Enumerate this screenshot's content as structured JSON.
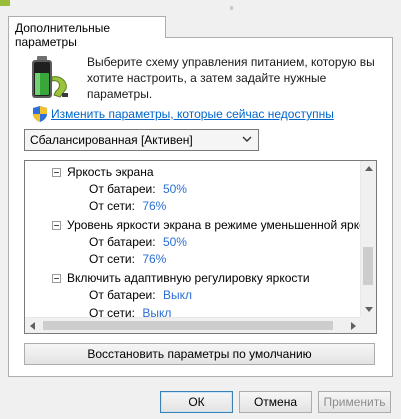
{
  "tab": {
    "label": "Дополнительные параметры"
  },
  "intro": {
    "text": "Выберите схему управления питанием, которую вы хотите настроить, а затем задайте нужные параметры."
  },
  "change_link": {
    "label": "Изменить параметры, которые сейчас недоступны"
  },
  "plan_select": {
    "value": "Сбалансированная [Активен]"
  },
  "tree": {
    "groups": [
      {
        "label": "Яркость экрана",
        "battery_label": "От батареи:",
        "battery_value": "50%",
        "ac_label": "От сети:",
        "ac_value": "76%"
      },
      {
        "label": "Уровень яркости экрана в режиме уменьшенной яркости",
        "battery_label": "От батареи:",
        "battery_value": "50%",
        "ac_label": "От сети:",
        "ac_value": "76%"
      },
      {
        "label": "Включить адаптивную регулировку яркости",
        "battery_label": "От батареи:",
        "battery_value": "Выкл",
        "ac_label": "От сети:",
        "ac_value": "Выкл"
      }
    ]
  },
  "restore_button": {
    "label": "Восстановить параметры по умолчанию"
  },
  "buttons": {
    "ok": "ОК",
    "cancel": "Отмена",
    "apply": "Применить"
  },
  "colors": {
    "link": "#0066cc",
    "value": "#2a6ed4",
    "battery_green": "#3aa63a"
  }
}
